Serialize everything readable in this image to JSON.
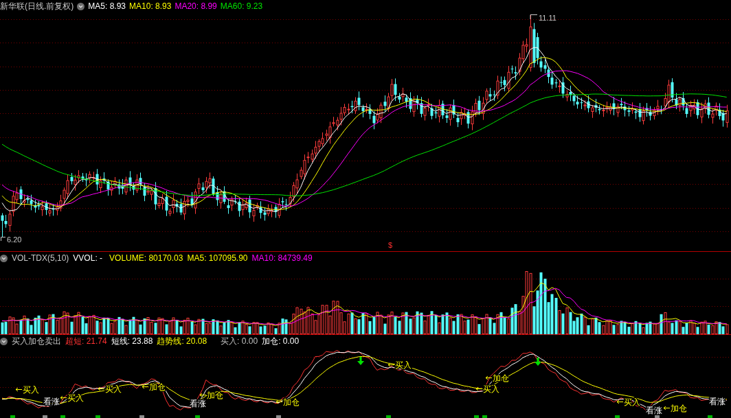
{
  "price_panel": {
    "title": "新华联(日线.前复权)",
    "indicators": [
      {
        "label": "MA5: 8.93",
        "color": "#ffffff"
      },
      {
        "label": "MA10: 8.93",
        "color": "#ffff00"
      },
      {
        "label": "MA20: 8.99",
        "color": "#ff00ff"
      },
      {
        "label": "MA60: 9.23",
        "color": "#00e600"
      }
    ],
    "high_label": "11.11",
    "low_label": "6.20",
    "marker": "$"
  },
  "volume_panel": {
    "title": "VOL-TDX(5,10)",
    "indicators": [
      {
        "label": "VVOL: -",
        "color": "#ffffff"
      },
      {
        "label": "VOLUME: 80170.03",
        "color": "#ffff00"
      },
      {
        "label": "MA5: 107095.90",
        "color": "#ffff00"
      },
      {
        "label": "MA10: 84739.49",
        "color": "#ff00ff"
      }
    ]
  },
  "signal_panel": {
    "title": "买入加仓卖出",
    "indicators": [
      {
        "label": "超短: 21.74",
        "color": "#ff3232"
      },
      {
        "label": "短线: 23.88",
        "color": "#ffffff"
      },
      {
        "label": "趋势线: 20.08",
        "color": "#ffff00"
      },
      {
        "label": "买入: 0.00",
        "color": "#c0c0c0"
      },
      {
        "label": "加仓: 0.00",
        "color": "#ffffff"
      }
    ],
    "signals": [
      {
        "text": "买入",
        "kind": "signal"
      },
      {
        "text": "看涨",
        "kind": "note"
      },
      {
        "text": "买入",
        "kind": "signal"
      },
      {
        "text": "买入",
        "kind": "signal"
      },
      {
        "text": "加仓",
        "kind": "signal"
      },
      {
        "text": "看涨",
        "kind": "note"
      },
      {
        "text": "加仓",
        "kind": "signal"
      },
      {
        "text": "加仓",
        "kind": "signal"
      },
      {
        "text": "买入",
        "kind": "signal"
      },
      {
        "text": "加仓",
        "kind": "signal"
      },
      {
        "text": "买入",
        "kind": "signal"
      },
      {
        "text": "买入",
        "kind": "signal"
      },
      {
        "text": "看涨",
        "kind": "note"
      },
      {
        "text": "加仓",
        "kind": "signal"
      },
      {
        "text": "看涨",
        "kind": "note"
      }
    ]
  }
}
